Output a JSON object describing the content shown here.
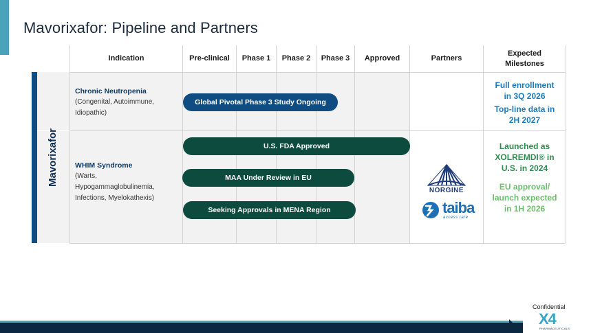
{
  "title": "Mavorixafor: Pipeline and Partners",
  "headers": {
    "indication": "Indication",
    "preclinical": "Pre-clinical",
    "phase1": "Phase 1",
    "phase2": "Phase 2",
    "phase3": "Phase 3",
    "approved": "Approved",
    "partners": "Partners",
    "milestones_line1": "Expected",
    "milestones_line2": "Milestones"
  },
  "drug": "Mavorixafor",
  "rows": [
    {
      "title": "Chronic Neutropenia",
      "sub": [
        "(Congenital, Autoimmune,",
        "Idiopathic)"
      ],
      "bars": [
        {
          "label": "Global Pivotal Phase 3 Study Ongoing",
          "reached_stage": "Phase 3",
          "color": "#0f4c81"
        }
      ],
      "milestones": [
        "Full enrollment",
        "in 3Q 2026",
        "Top-line data in",
        "2H 2027"
      ]
    },
    {
      "title": "WHIM Syndrome",
      "sub": [
        "(Warts,",
        "Hypogammaglobulinemia,",
        "Infections, Myelokathexis)"
      ],
      "bars": [
        {
          "label": "U.S. FDA Approved",
          "reached_stage": "Approved",
          "color": "#0d4b3e"
        },
        {
          "label": "MAA Under Review in EU",
          "reached_stage": "Phase 3",
          "color": "#0d4b3e"
        },
        {
          "label": "Seeking Approvals in MENA Region",
          "reached_stage": "Phase 3",
          "color": "#0d4b3e"
        }
      ],
      "milestones": [
        "Launched as",
        "XOLREMDI® in",
        "U.S. in 2024",
        "EU approval/",
        "launch expected",
        "in 1H 2026"
      ]
    }
  ],
  "partners": {
    "norgine": "NORGINE",
    "taiba": "taiba",
    "taiba_tagline": "access rare"
  },
  "footer": {
    "confidential": "Confidential",
    "logo": "X4",
    "logo_sub": "PHARMACEUTICALS"
  },
  "colors": {
    "accent": "#4aa3b9",
    "navy": "#0f4c81",
    "dark_green": "#0d4b3e",
    "milestone_blue": "#1a7bbf",
    "milestone_green": "#2f8b4e",
    "milestone_lightgreen": "#6cbf6a"
  }
}
